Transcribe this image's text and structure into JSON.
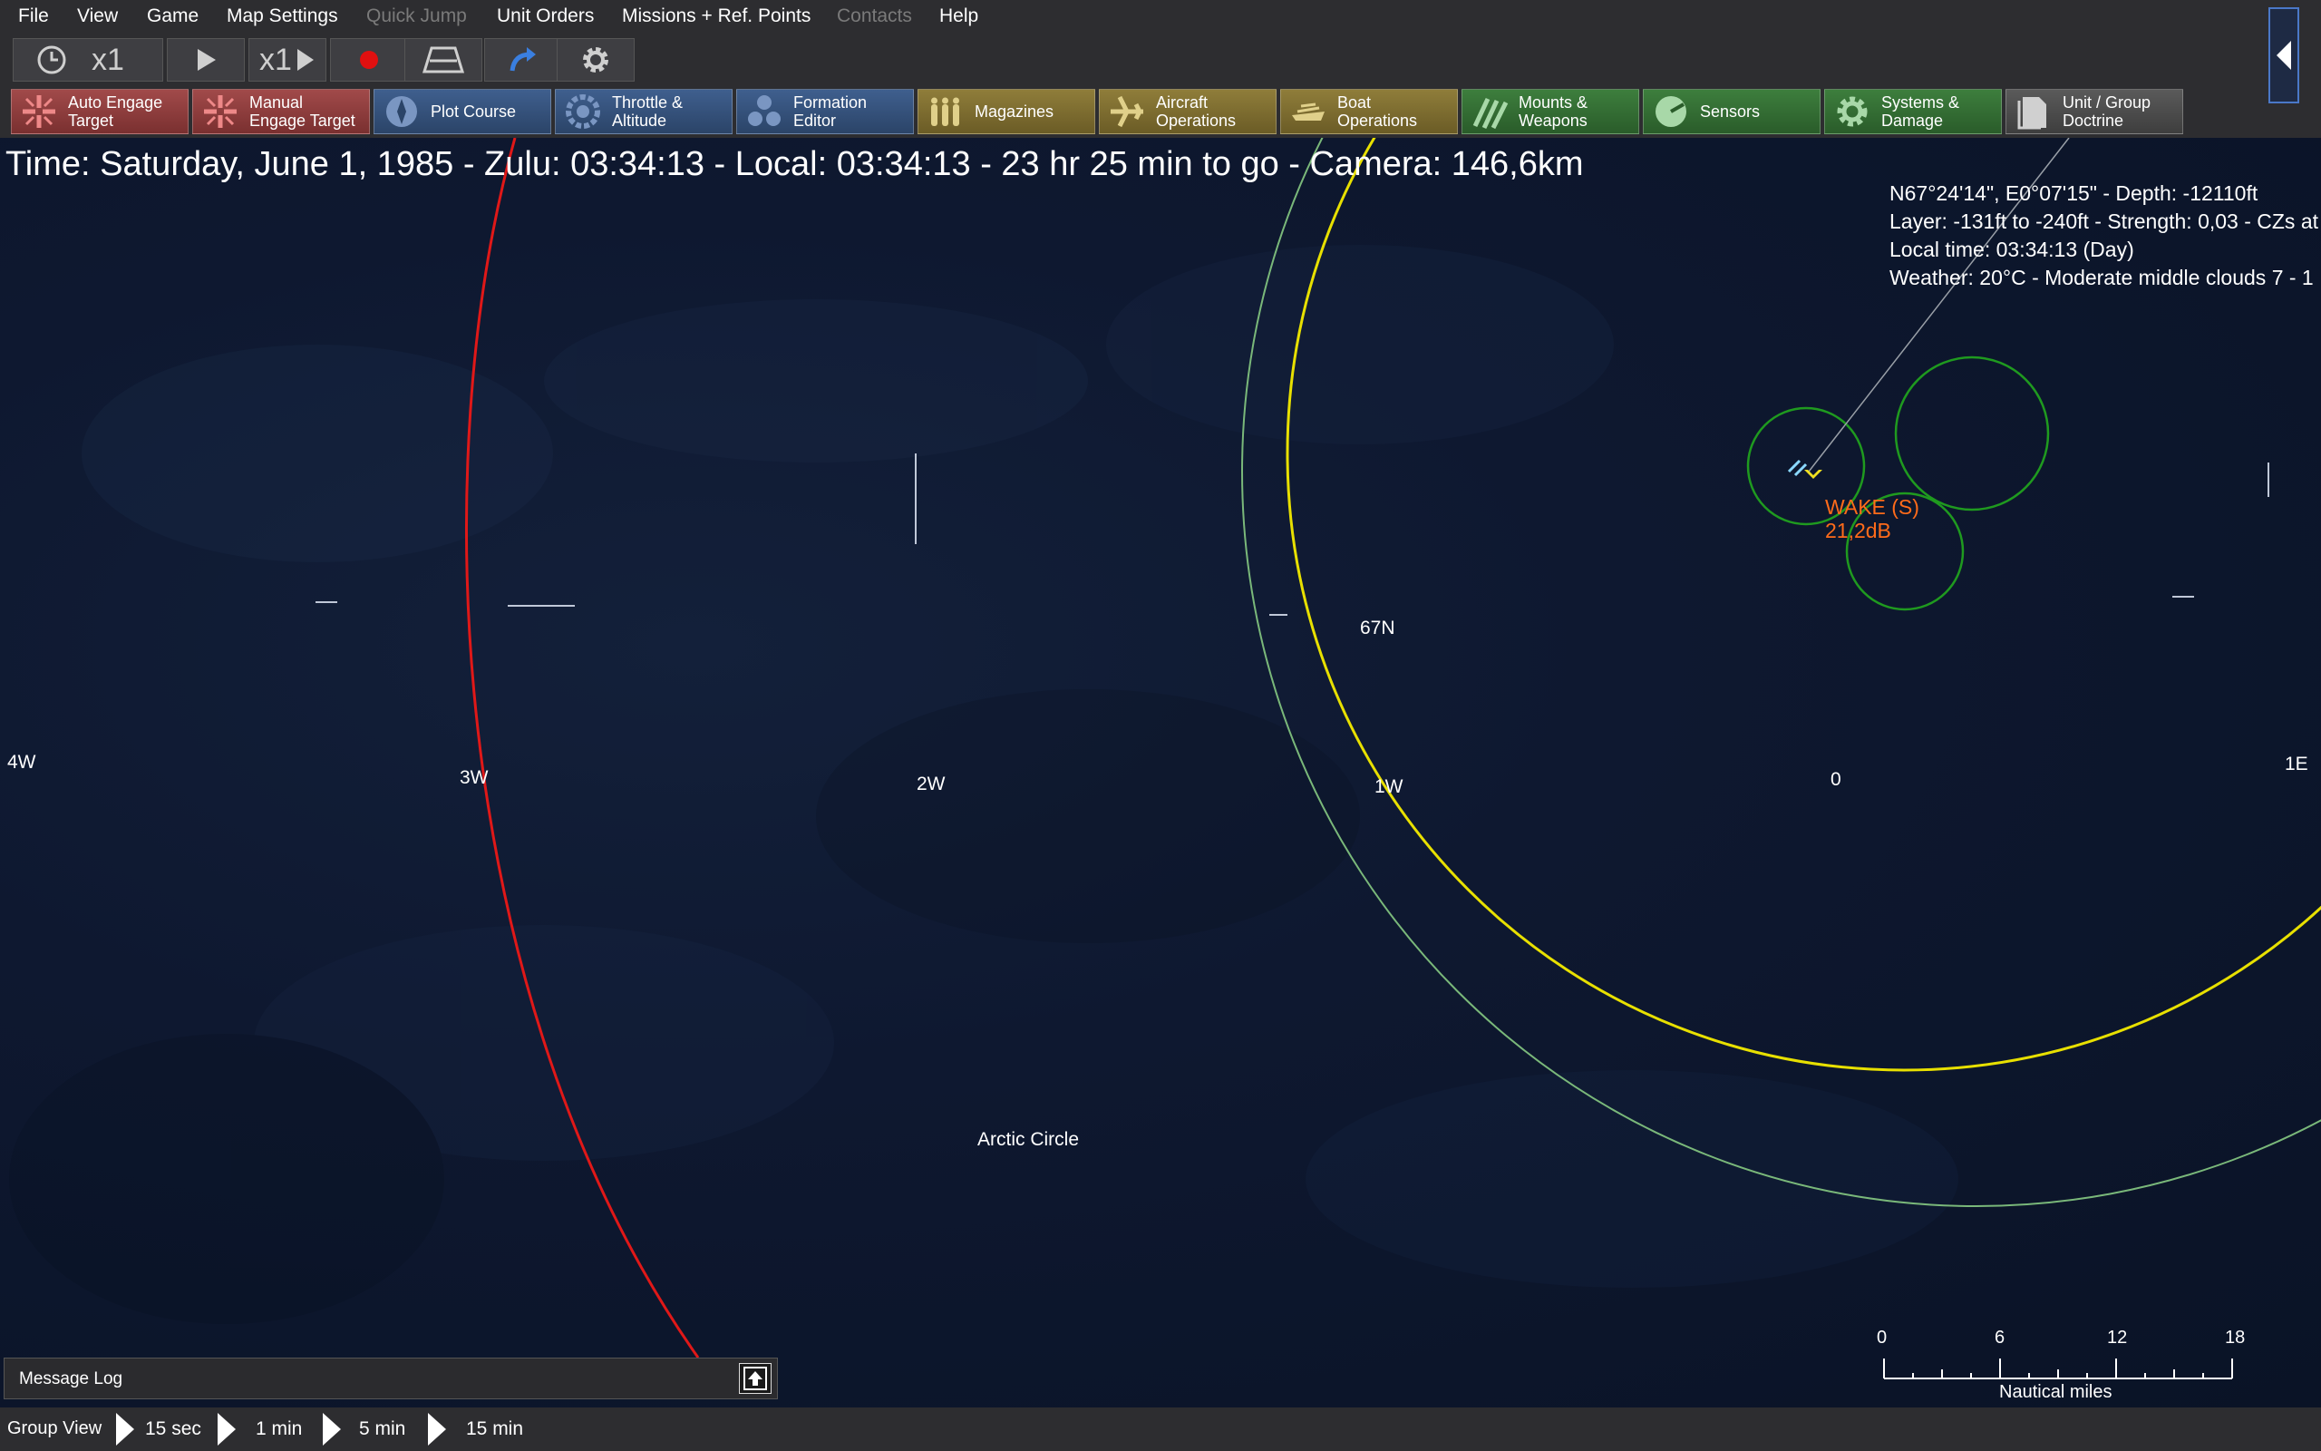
{
  "menu": {
    "items": [
      "File",
      "View",
      "Game",
      "Map Settings",
      "Quick Jump",
      "Unit Orders",
      "Missions + Ref. Points",
      "Contacts",
      "Help"
    ]
  },
  "toolbar": {
    "clock_speed_label": "x1",
    "play_speed_label": "x1"
  },
  "actions": [
    {
      "label": "Auto Engage\nTarget",
      "color": "red"
    },
    {
      "label": "Manual\nEngage Target",
      "color": "red"
    },
    {
      "label": "Plot Course",
      "color": "blue"
    },
    {
      "label": "Throttle &\nAltitude",
      "color": "blue"
    },
    {
      "label": "Formation\nEditor",
      "color": "blue"
    },
    {
      "label": "Magazines",
      "color": "gold"
    },
    {
      "label": "Aircraft\nOperations",
      "color": "gold"
    },
    {
      "label": "Boat\nOperations",
      "color": "gold"
    },
    {
      "label": "Mounts &\nWeapons",
      "color": "green"
    },
    {
      "label": "Sensors",
      "color": "green"
    },
    {
      "label": "Systems &\nDamage",
      "color": "green"
    },
    {
      "label": "Unit / Group\nDoctrine",
      "color": "gray"
    }
  ],
  "status_line": "Time: Saturday, June 1, 1985 - Zulu: 03:34:13 - Local: 03:34:13 - 23 hr 25 min to go - Camera: 146,6km",
  "cursor_info": {
    "position": "N67°24'14\", E0°07'15\" - Depth: -12110ft",
    "layer": "Layer: -131ft to -240ft - Strength: 0,03 - CZs at",
    "local_time": "Local time: 03:34:13 (Day)",
    "weather": "Weather: 20°C - Moderate middle clouds 7 - 1"
  },
  "map_labels": {
    "lon_4w": "4W",
    "lon_3w": "3W",
    "lon_2w": "2W",
    "lon_1w": "1W",
    "lon_0": "0",
    "lon_1e": "1E",
    "lat_67n": "67N",
    "arctic_circle": "Arctic Circle"
  },
  "contact": {
    "name": "WAKE (S)",
    "strength": "21,2dB"
  },
  "message_log": {
    "title": "Message Log"
  },
  "bottom_bar": {
    "group_view": "Group View",
    "steps": [
      "15 sec",
      "1 min",
      "5 min",
      "15 min"
    ]
  },
  "scale": {
    "ticks": [
      "0",
      "6",
      "12",
      "18"
    ],
    "caption": "Nautical miles"
  },
  "colors": {
    "range_ring_red": "#e01818",
    "range_ring_yellow": "#e8e000",
    "range_ring_green": "#7ab87a",
    "sensor_circle": "#1f9a1f",
    "contact_orange": "#ff6b1a"
  }
}
